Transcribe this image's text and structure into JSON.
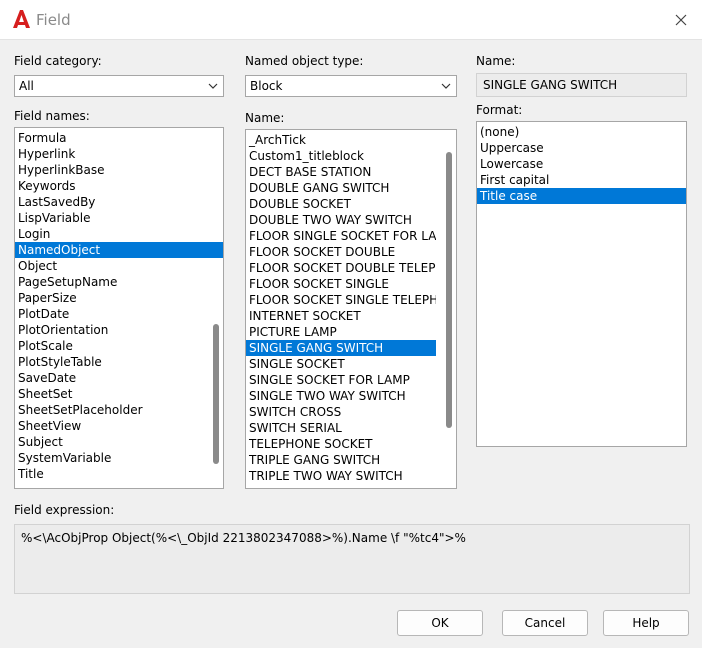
{
  "window": {
    "title": "Field",
    "accent": "#0078d7",
    "app_icon": "autocad-icon",
    "close_icon": "close-icon"
  },
  "field_category": {
    "label": "Field category:",
    "value": "All"
  },
  "field_names": {
    "label": "Field names:",
    "items": [
      "Formula",
      "Hyperlink",
      "HyperlinkBase",
      "Keywords",
      "LastSavedBy",
      "LispVariable",
      "Login",
      "NamedObject",
      "Object",
      "PageSetupName",
      "PaperSize",
      "PlotDate",
      "PlotOrientation",
      "PlotScale",
      "PlotStyleTable",
      "SaveDate",
      "SheetSet",
      "SheetSetPlaceholder",
      "SheetView",
      "Subject",
      "SystemVariable",
      "Title"
    ],
    "selected": "NamedObject"
  },
  "named_object_type": {
    "label": "Named object type:",
    "value": "Block"
  },
  "names": {
    "label": "Name:",
    "items": [
      "_ArchTick",
      "Custom1_titleblock",
      "DECT BASE STATION",
      "DOUBLE GANG SWITCH",
      "DOUBLE SOCKET",
      "DOUBLE TWO WAY SWITCH",
      "FLOOR SINGLE SOCKET FOR LAMP",
      "FLOOR SOCKET DOUBLE",
      "FLOOR SOCKET DOUBLE TELEPHONE",
      "FLOOR SOCKET SINGLE",
      "FLOOR SOCKET SINGLE TELEPHONE",
      "INTERNET SOCKET",
      "PICTURE LAMP",
      "SINGLE GANG SWITCH",
      "SINGLE SOCKET",
      "SINGLE SOCKET FOR LAMP",
      "SINGLE TWO WAY SWITCH",
      "SWITCH CROSS",
      "SWITCH SERIAL",
      "TELEPHONE SOCKET",
      "TRIPLE GANG SWITCH",
      "TRIPLE TWO WAY SWITCH"
    ],
    "selected": "SINGLE GANG SWITCH"
  },
  "name_display": {
    "label": "Name:",
    "value": "SINGLE GANG SWITCH"
  },
  "format": {
    "label": "Format:",
    "items": [
      "(none)",
      "Uppercase",
      "Lowercase",
      "First capital",
      "Title case"
    ],
    "selected": "Title case"
  },
  "field_expression": {
    "label": "Field expression:",
    "value": "%<\\AcObjProp Object(%<\\_ObjId 2213802347088>%).Name \\f \"%tc4\">%"
  },
  "buttons": {
    "ok": "OK",
    "cancel": "Cancel",
    "help": "Help"
  }
}
